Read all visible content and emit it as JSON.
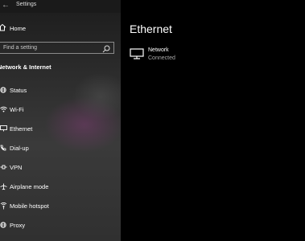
{
  "window": {
    "title": "Settings"
  },
  "sidebar": {
    "home_label": "Home",
    "search_placeholder": "Find a setting",
    "section_heading": "Network & Internet",
    "items": [
      {
        "label": "Status",
        "icon": "globe-icon"
      },
      {
        "label": "Wi-Fi",
        "icon": "wifi-icon"
      },
      {
        "label": "Ethernet",
        "icon": "ethernet-icon"
      },
      {
        "label": "Dial-up",
        "icon": "phone-icon"
      },
      {
        "label": "VPN",
        "icon": "vpn-icon"
      },
      {
        "label": "Airplane mode",
        "icon": "airplane-icon"
      },
      {
        "label": "Mobile hotspot",
        "icon": "hotspot-icon"
      },
      {
        "label": "Proxy",
        "icon": "globe-icon"
      }
    ]
  },
  "main": {
    "title": "Ethernet",
    "network": {
      "name": "Network",
      "status": "Connected"
    }
  },
  "colors": {
    "background": "#000000",
    "text": "#ffffff",
    "muted": "#a8a8a8"
  }
}
